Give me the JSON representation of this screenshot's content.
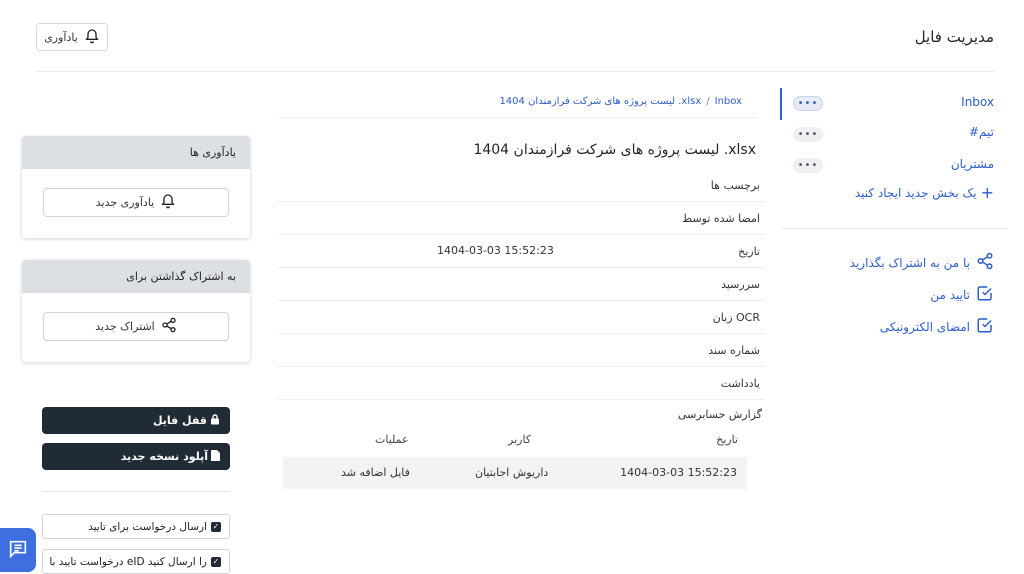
{
  "header": {
    "title": "مدیریت فایل",
    "reminder_button": "یادآوری"
  },
  "sidebar": {
    "items": [
      {
        "label": "Inbox",
        "more": "•••"
      },
      {
        "label": "#تیم",
        "more": "•••"
      },
      {
        "label": "مشتریان",
        "more": "•••"
      }
    ],
    "add_section": "یک بخش جدید ایجاد کنید",
    "links": [
      {
        "label": "با من به اشتراک بگذارید",
        "icon": "share-icon"
      },
      {
        "label": "تایید من",
        "icon": "checkbox-icon"
      },
      {
        "label": "امضای الکترونیکی",
        "icon": "checkbox-icon"
      }
    ]
  },
  "breadcrumb": {
    "root": "Inbox",
    "separator": "/",
    "current": "لیست پروژه های شرکت فرازمندان 1404 .xlsx"
  },
  "document": {
    "title": "لیست پروژه های شرکت فرازمندان 1404 .xlsx",
    "fields": [
      {
        "label": "برچسب ها",
        "value": ""
      },
      {
        "label": "امضا شده توسط",
        "value": ""
      },
      {
        "label": "تاریخ",
        "value": "1404-03-03 15:52:23"
      },
      {
        "label": "سررسید",
        "value": ""
      },
      {
        "label": "زبان OCR",
        "value": ""
      },
      {
        "label": "شماره سند",
        "value": ""
      },
      {
        "label": "یادداشت",
        "value": ""
      }
    ]
  },
  "audit": {
    "title": "گزارش حسابرسی",
    "columns": [
      "تاریخ",
      "کاربر",
      "عملیات"
    ],
    "rows": [
      {
        "date": "1404-03-03 15:52:23",
        "user": "داریوش اجابتیان",
        "action": "فایل اضافه شد"
      }
    ]
  },
  "reminders_panel": {
    "title": "یادآوری ها",
    "button": "یادآوری جدید"
  },
  "share_panel": {
    "title": "به اشتراک گذاشتن برای",
    "button": "اشتراک جدید"
  },
  "actions": {
    "lock": "قفل فایل",
    "upload": "آپلود نسخه جدید",
    "send_approval": "ارسال درخواست برای تایید",
    "eid_request": "درخواست تایید با eID را ارسال کنید"
  },
  "colors": {
    "accent": "#2d5ec9",
    "dark_button": "#212b36",
    "panel_header": "#dcdfe4",
    "fab": "#3e6ee0"
  }
}
